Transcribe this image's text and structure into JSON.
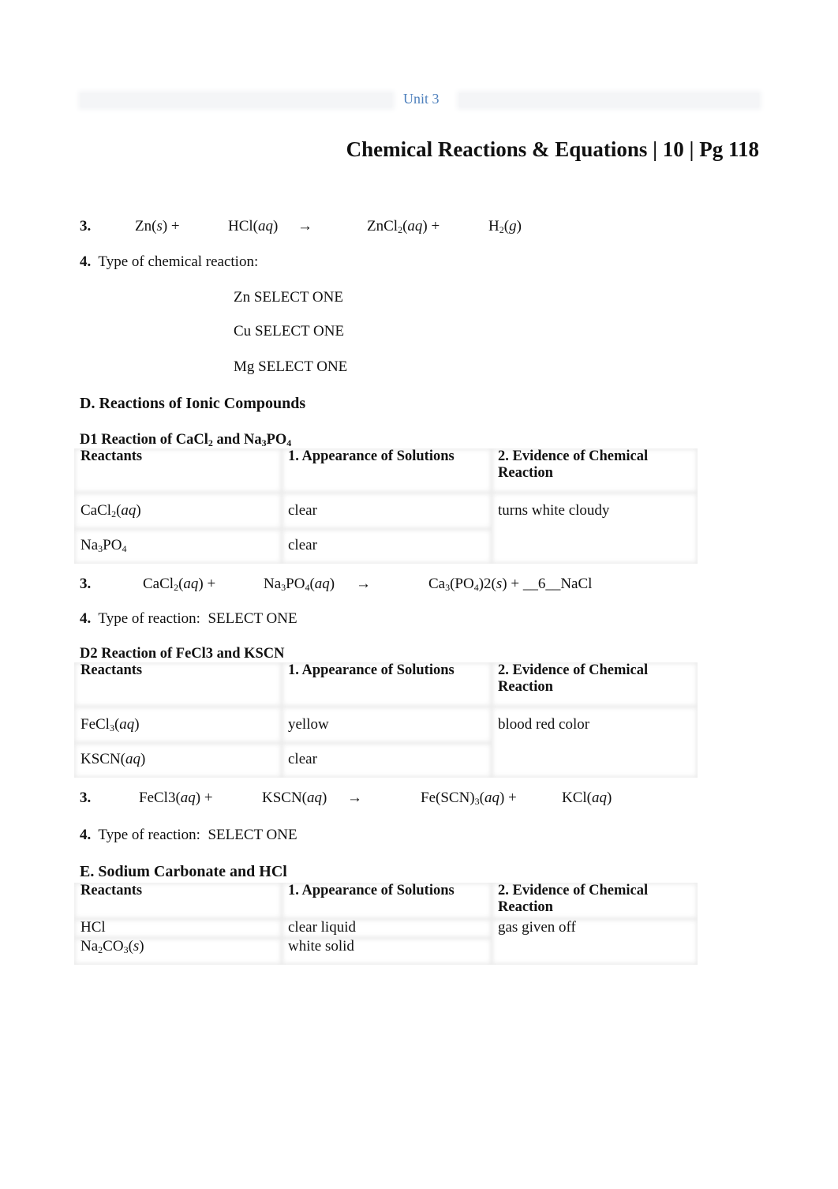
{
  "header": {
    "unit": "Unit 3",
    "title": "Chemical Reactions & Equations | 10 | Pg 118"
  },
  "section_c": {
    "q3": {
      "num": "3.",
      "r1": "Zn(",
      "r1_state": "s",
      "r1_close": ")  +",
      "r2": "HCl(",
      "r2_state": "aq",
      "r2_close": ")",
      "arrow": "→",
      "p1a": "ZnCl",
      "p1_sub": "2",
      "p1b": "(",
      "p1_state": "aq",
      "p1_close": ")  +",
      "p2a": "H",
      "p2_sub": "2",
      "p2b": "(",
      "p2_state": "g",
      "p2_close": ")"
    },
    "q4": {
      "num": "4.",
      "label": "Type of chemical reaction:",
      "selects": [
        {
          "metal": "Zn",
          "value": "SELECT ONE"
        },
        {
          "metal": "Cu",
          "value": "SELECT ONE"
        },
        {
          "metal": "Mg",
          "value": "SELECT ONE"
        }
      ]
    }
  },
  "section_d": {
    "heading": "D.  Reactions of Ionic Compounds",
    "d1": {
      "title_a": "D1 Reaction of CaCl",
      "title_sub1": "2",
      "title_b": " and Na",
      "title_sub2": "3",
      "title_c": "PO",
      "title_sub3": "4",
      "columns": [
        "Reactants",
        "1. Appearance of Solutions",
        "2. Evidence of Chemical Reaction"
      ],
      "rows": [
        {
          "reactant_a": "CaCl",
          "reactant_sub": "2",
          "reactant_b": "(",
          "reactant_state": "aq",
          "reactant_c": ")",
          "appearance": "clear"
        },
        {
          "reactant_a": "Na",
          "reactant_sub": "3",
          "reactant_b": "PO",
          "reactant_sub2": "4",
          "appearance": "clear"
        }
      ],
      "evidence": "turns white cloudy",
      "q3": {
        "num": "3.",
        "r1a": "CaCl",
        "r1_sub": "2",
        "r1b": "(",
        "r1_state": "aq",
        "r1_close": ") +",
        "r2a": "Na",
        "r2_sub": "3",
        "r2b": "PO",
        "r2_sub2": "4",
        "r2c": "(",
        "r2_state": "aq",
        "r2_close": ")",
        "arrow": "→",
        "p1a": "Ca",
        "p1_sub": "3",
        "p1b": "(PO",
        "p1_sub2": "4",
        "p1c": ")2(",
        "p1_state": "s",
        "p1_close": ") + __6__NaCl"
      },
      "q4": {
        "num": "4.",
        "label": "Type of reaction:",
        "value": "SELECT ONE"
      }
    },
    "d2": {
      "title": "D2 Reaction of FeCl3  and KSCN",
      "columns": [
        "Reactants",
        "1. Appearance of Solutions",
        "2. Evidence of Chemical Reaction"
      ],
      "rows": [
        {
          "reactant_a": "FeCl",
          "reactant_sub": "3",
          "reactant_b": "(",
          "reactant_state": "aq",
          "reactant_c": ")",
          "appearance": "yellow"
        },
        {
          "reactant_a": "KSCN(",
          "reactant_state": "aq",
          "reactant_c": ")",
          "appearance": "clear"
        }
      ],
      "evidence": "blood red color",
      "q3": {
        "num": "3.",
        "r1a": "FeCl3(",
        "r1_state": "aq",
        "r1_close": ") +",
        "r2a": "KSCN(",
        "r2_state": "aq",
        "r2_close": ")",
        "arrow": "→",
        "p1a": "Fe(SCN)",
        "p1_sub": "3",
        "p1b": "(",
        "p1_state": "aq",
        "p1_close": ") +",
        "p2a": "KCl(",
        "p2_state": "aq",
        "p2_close": ")"
      },
      "q4": {
        "num": "4.",
        "label": "Type of reaction:",
        "value": "SELECT ONE"
      }
    }
  },
  "section_e": {
    "heading": "E.  Sodium Carbonate and HCl",
    "columns": [
      "Reactants",
      "1. Appearance of Solutions",
      "2. Evidence of Chemical Reaction"
    ],
    "rows": [
      {
        "reactant": "HCl",
        "appearance": "clear liquid"
      },
      {
        "reactant_a": "Na",
        "reactant_sub": "2",
        "reactant_b": "CO",
        "reactant_sub2": "3",
        "reactant_c": "(",
        "reactant_state": "s",
        "reactant_d": ")",
        "appearance": "white solid"
      }
    ],
    "evidence": "gas given off"
  }
}
